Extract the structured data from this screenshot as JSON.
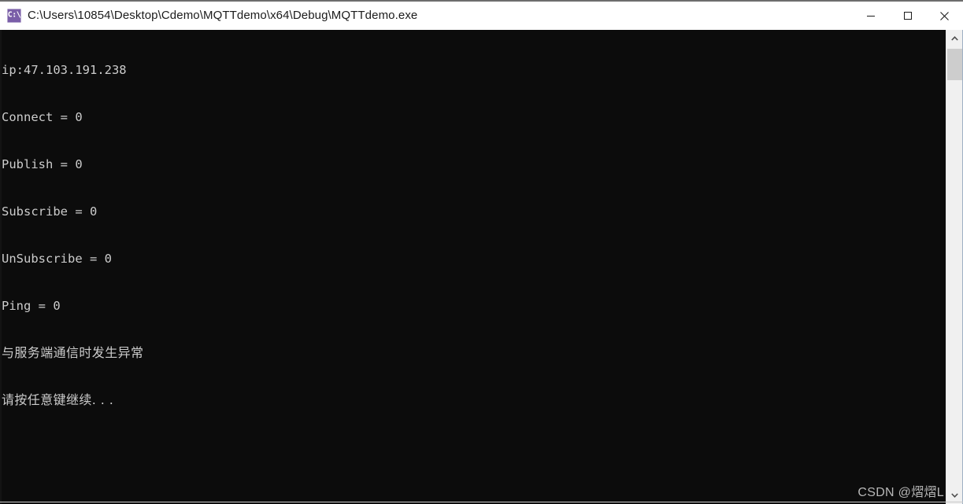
{
  "window": {
    "title": "C:\\Users\\10854\\Desktop\\Cdemo\\MQTTdemo\\x64\\Debug\\MQTTdemo.exe",
    "icon_glyph": "C:\\",
    "icon_name": "console-app-icon",
    "icon_color": "#7a5ea8",
    "titlebar_background": "#ffffff",
    "title_color": "#1b1b1b"
  },
  "controls": {
    "minimize_label": "Minimize",
    "maximize_label": "Maximize",
    "close_label": "Close"
  },
  "console": {
    "background": "#0c0c0c",
    "foreground": "#cccccc",
    "lines": [
      "ip:47.103.191.238",
      "Connect = 0",
      "Publish = 0",
      "Subscribe = 0",
      "UnSubscribe = 0",
      "Ping = 0",
      "与服务端通信时发生异常",
      "请按任意键继续. . ."
    ]
  },
  "watermark": {
    "text": "CSDN @熠熠L",
    "color": "#b7b7b7"
  },
  "scrollbar": {
    "track_color": "#f0f0f0",
    "thumb_color": "#cdcdcd",
    "up_arrow": "scroll-up-arrow",
    "down_arrow": "scroll-down-arrow"
  }
}
